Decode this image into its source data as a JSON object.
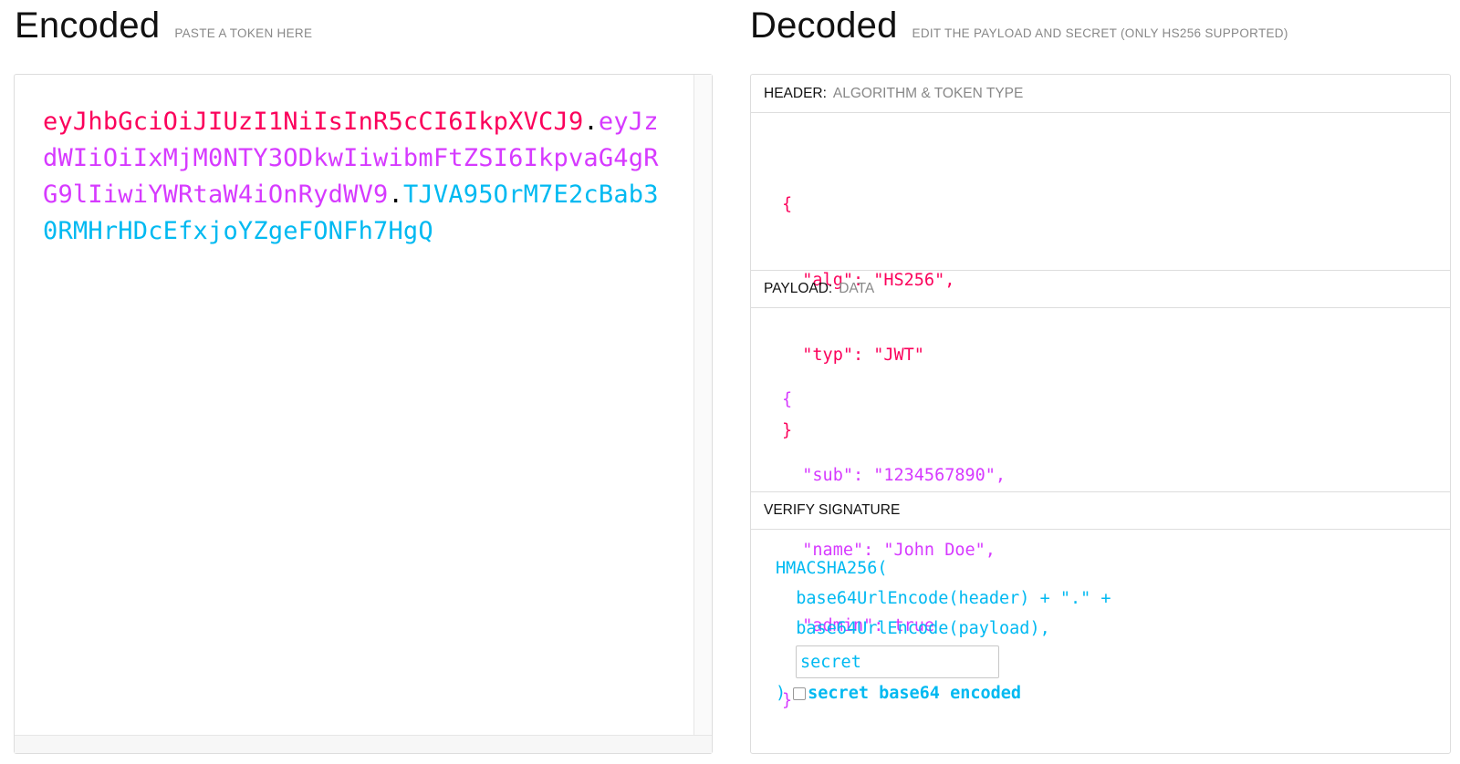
{
  "encoded": {
    "title": "Encoded",
    "subtitle": "PASTE A TOKEN HERE",
    "token": {
      "header": "eyJhbGciOiJIUzI1NiIsInR5cCI6IkpXVCJ9",
      "dot1": ".",
      "payload": "eyJzdWIiOiIxMjM0NTY3ODkwIiwibmFtZSI6IkpvaG4gRG9lIiwiYWRtaW4iOnRydWV9",
      "dot2": ".",
      "signature": "TJVA95OrM7E2cBab30RMHrHDcEfxjoYZgeFONFh7HgQ"
    }
  },
  "decoded": {
    "title": "Decoded",
    "subtitle": "EDIT THE PAYLOAD AND SECRET (ONLY HS256 SUPPORTED)",
    "header_section": {
      "label": "HEADER:",
      "hint": "ALGORITHM & TOKEN TYPE",
      "lines": [
        "{",
        "  \"alg\": \"HS256\",",
        "  \"typ\": \"JWT\"",
        "}"
      ]
    },
    "payload_section": {
      "label": "PAYLOAD:",
      "hint": "DATA",
      "lines": [
        "{",
        "  \"sub\": \"1234567890\",",
        "  \"name\": \"John Doe\",",
        "  \"admin\": true",
        "}"
      ]
    },
    "verify_section": {
      "label": "VERIFY SIGNATURE",
      "line1": "HMACSHA256(",
      "line2": "  base64UrlEncode(header) + \".\" +",
      "line3": "  base64UrlEncode(payload),",
      "secret_placeholder": "secret",
      "close_paren": ")",
      "checkbox_label": "secret base64 encoded"
    }
  },
  "colors": {
    "header": "#fb015b",
    "payload": "#d63aff",
    "signature": "#00b9f1"
  }
}
